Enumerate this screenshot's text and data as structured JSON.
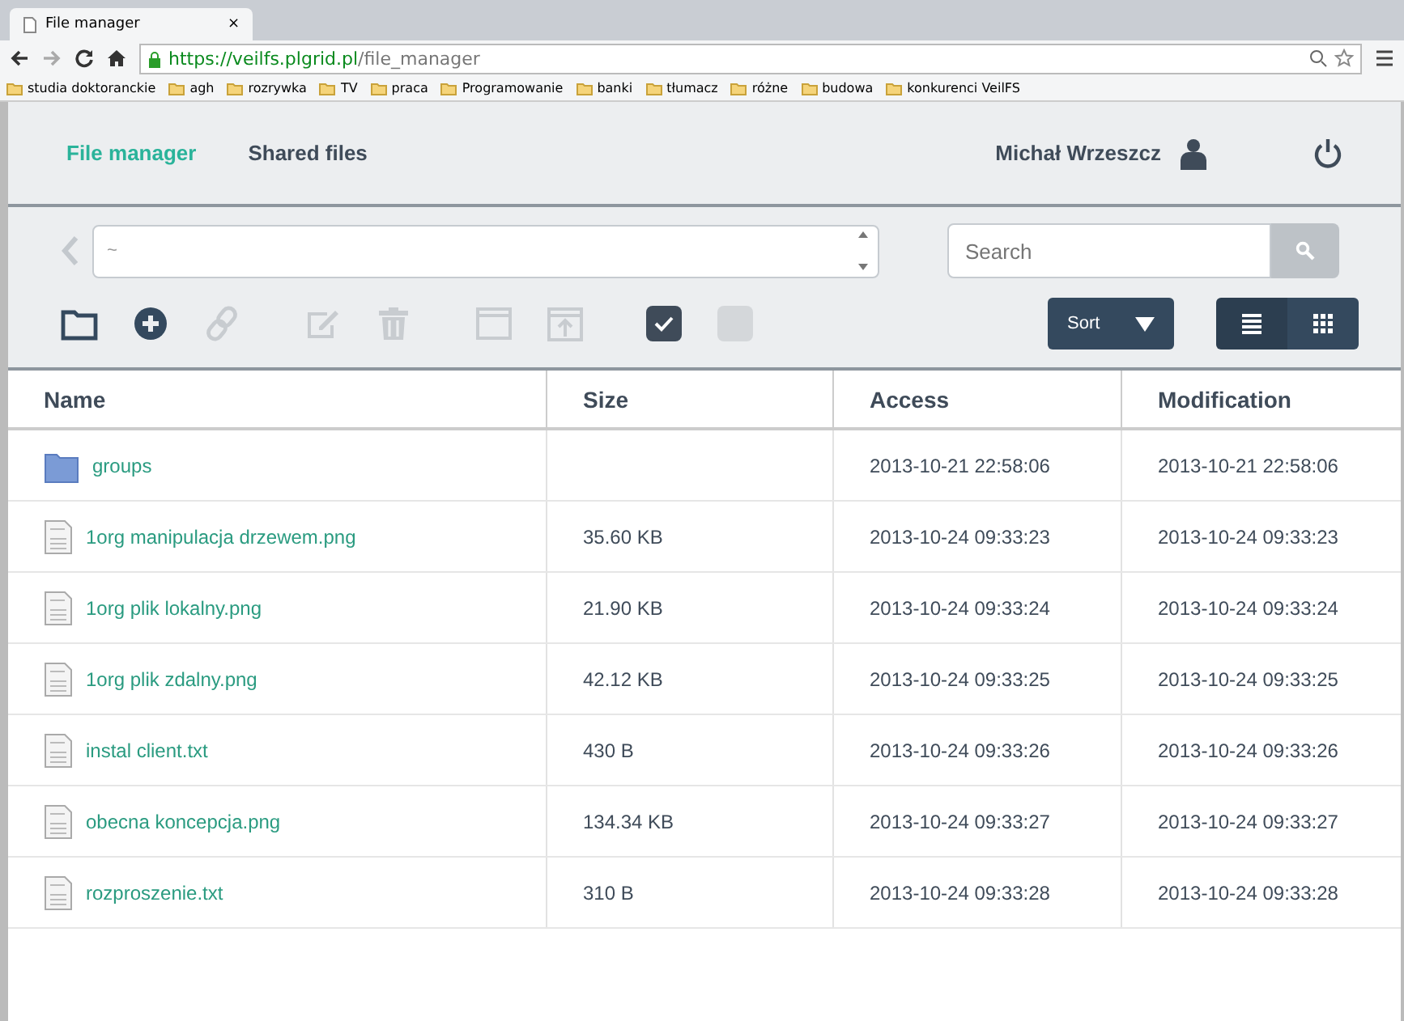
{
  "browser": {
    "tab_title": "File manager",
    "tab_close": "×",
    "url_host": "https://veilfs.plgrid.pl",
    "url_path": "/file_manager",
    "bookmarks": [
      "studia doktoranckie",
      "agh",
      "rozrywka",
      "TV",
      "praca",
      "Programowanie",
      "banki",
      "tłumacz",
      "różne",
      "budowa",
      "konkurenci VeilFS"
    ]
  },
  "nav": {
    "tabs": [
      {
        "label": "File manager",
        "selected": true
      },
      {
        "label": "Shared files",
        "selected": false
      }
    ],
    "user": "Michał Wrzeszcz"
  },
  "path": {
    "value": "~"
  },
  "search": {
    "placeholder": "Search"
  },
  "toolbar": [
    {
      "kind": "folder",
      "disabled": false
    },
    {
      "kind": "plus",
      "disabled": false
    },
    {
      "kind": "link",
      "disabled": true
    },
    {
      "kind": "edit",
      "disabled": true
    },
    {
      "kind": "trash",
      "disabled": true
    },
    {
      "kind": "window",
      "disabled": true
    },
    {
      "kind": "upload",
      "disabled": true
    },
    {
      "kind": "checkbox",
      "checked": true
    },
    {
      "kind": "checkbox",
      "checked": false
    }
  ],
  "sort": {
    "label": "Sort"
  },
  "view": [
    {
      "kind": "list",
      "selected": true
    },
    {
      "kind": "grid",
      "selected": false
    }
  ],
  "table": {
    "columns": [
      "Name",
      "Size",
      "Access",
      "Modification"
    ],
    "rows": [
      {
        "kind": "folder",
        "name": "groups",
        "size": "",
        "access": "2013-10-21 22:58:06",
        "modification": "2013-10-21 22:58:06"
      },
      {
        "kind": "file",
        "name": "1org manipulacja drzewem.png",
        "size": "35.60 KB",
        "access": "2013-10-24 09:33:23",
        "modification": "2013-10-24 09:33:23"
      },
      {
        "kind": "file",
        "name": "1org plik lokalny.png",
        "size": "21.90 KB",
        "access": "2013-10-24 09:33:24",
        "modification": "2013-10-24 09:33:24"
      },
      {
        "kind": "file",
        "name": "1org plik zdalny.png",
        "size": "42.12 KB",
        "access": "2013-10-24 09:33:25",
        "modification": "2013-10-24 09:33:25"
      },
      {
        "kind": "file",
        "name": "instal client.txt",
        "size": "430 B",
        "access": "2013-10-24 09:33:26",
        "modification": "2013-10-24 09:33:26"
      },
      {
        "kind": "file",
        "name": "obecna koncepcja.png",
        "size": "134.34 KB",
        "access": "2013-10-24 09:33:27",
        "modification": "2013-10-24 09:33:27"
      },
      {
        "kind": "file",
        "name": "rozproszenie.txt",
        "size": "310 B",
        "access": "2013-10-24 09:33:28",
        "modification": "2013-10-24 09:33:28"
      }
    ]
  }
}
